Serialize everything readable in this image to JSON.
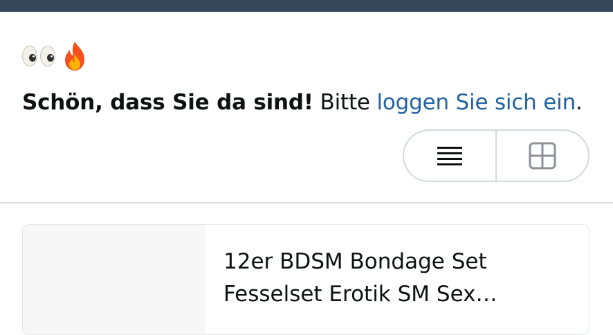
{
  "header": {
    "bar_color": "#37475a"
  },
  "emojis": [
    "eyes-emoji",
    "fire-emoji"
  ],
  "greeting": {
    "bold_text": "Schön, dass Sie da sind!",
    "plain_text": " Bitte ",
    "link_text": "loggen Sie sich ein",
    "end_text": ".",
    "link_color": "#2162a1"
  },
  "view_toggle": {
    "options": [
      "list-view-icon",
      "grid-view-icon"
    ]
  },
  "products": [
    {
      "title_line1": "12er BDSM Bondage Set",
      "title_line2": "Fesselset Erotik SM Sex…"
    }
  ]
}
